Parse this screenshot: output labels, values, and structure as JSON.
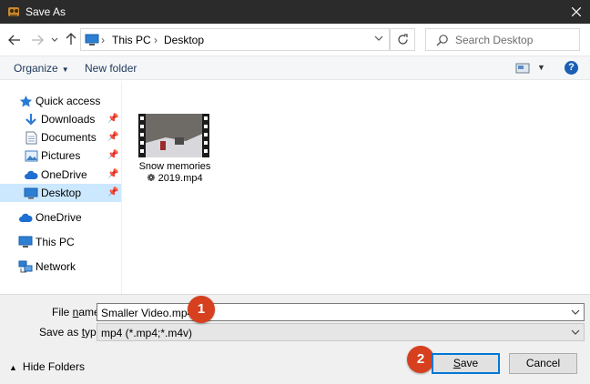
{
  "window": {
    "title": "Save As"
  },
  "address": {
    "crumbs": [
      "This PC",
      "Desktop"
    ]
  },
  "search": {
    "placeholder": "Search Desktop"
  },
  "toolbar": {
    "organize_label": "Organize",
    "new_folder_label": "New folder",
    "help_label": "?"
  },
  "sidebar": {
    "items": [
      {
        "label": "Quick access"
      },
      {
        "label": "Downloads",
        "pinned": true
      },
      {
        "label": "Documents",
        "pinned": true
      },
      {
        "label": "Pictures",
        "pinned": true
      },
      {
        "label": "OneDrive",
        "pinned": true
      },
      {
        "label": "Desktop",
        "pinned": true,
        "selected": true
      },
      {
        "label": "OneDrive"
      },
      {
        "label": "This PC"
      },
      {
        "label": "Network"
      }
    ]
  },
  "files": [
    {
      "name_line1": "Snow memories",
      "name_line2": "2019.mp4"
    }
  ],
  "form": {
    "file_name_label_u": "File ",
    "file_name_label_key": "n",
    "file_name_label_rest": "ame:",
    "file_name_value": "Smaller Video.mp4",
    "save_type_label_pre": "Save as ",
    "save_type_label_key": "t",
    "save_type_label_rest": "ype:",
    "save_type_value": "mp4 (*.mp4;*.m4v)"
  },
  "footer": {
    "hide_folders_label": "Hide Folders",
    "save_label_key": "S",
    "save_label_rest": "ave",
    "cancel_label": "Cancel"
  },
  "annotations": {
    "badge1": "1",
    "badge2": "2"
  },
  "colors": {
    "accent": "#0078d7",
    "badge": "#d6401f",
    "selection": "#cce8ff",
    "titlebar": "#2b2b2b"
  }
}
